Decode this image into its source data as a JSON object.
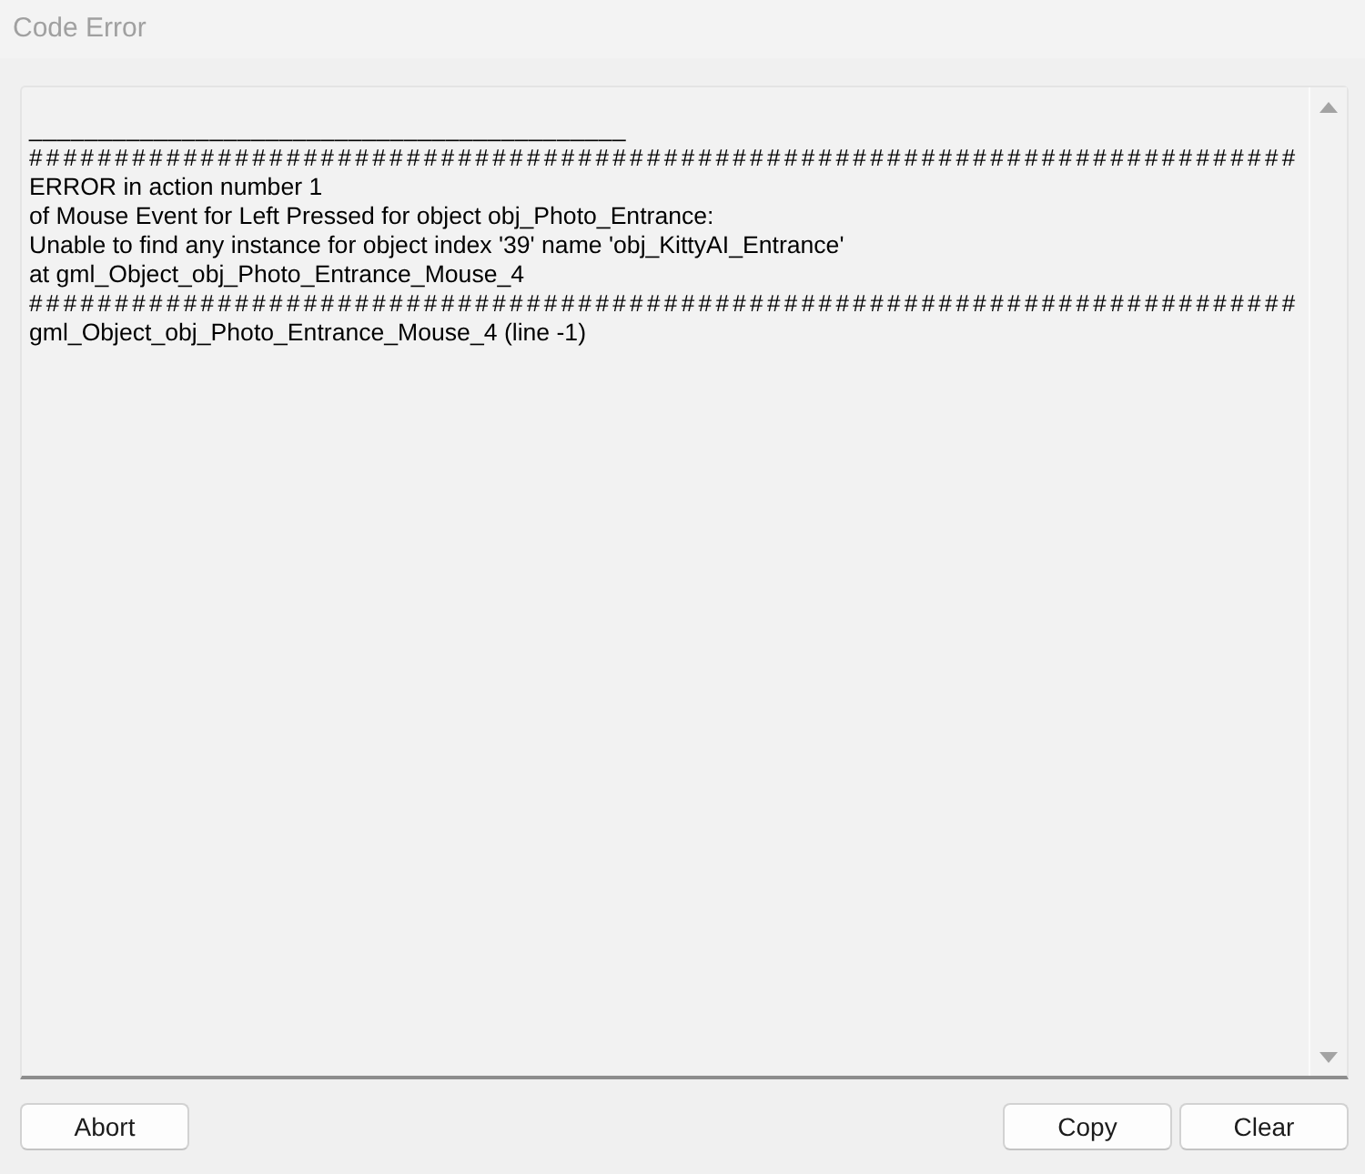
{
  "window": {
    "title": "Code Error"
  },
  "error_log": {
    "lines": [
      {
        "kind": "header",
        "text": "___________________________________________"
      },
      {
        "kind": "separator",
        "text": "##########################################################################"
      },
      {
        "kind": "message",
        "text": "ERROR in action number 1"
      },
      {
        "kind": "message",
        "text": "of Mouse Event for Left Pressed for object obj_Photo_Entrance:"
      },
      {
        "kind": "message",
        "text": "Unable to find any instance for object index '39' name 'obj_KittyAI_Entrance'"
      },
      {
        "kind": "message",
        "text": "at gml_Object_obj_Photo_Entrance_Mouse_4"
      },
      {
        "kind": "separator",
        "text": "##########################################################################"
      },
      {
        "kind": "message",
        "text": "gml_Object_obj_Photo_Entrance_Mouse_4 (line -1)"
      }
    ]
  },
  "buttons": {
    "left": [
      {
        "label": "Abort"
      }
    ],
    "right": [
      {
        "label": "Copy"
      },
      {
        "label": "Clear"
      }
    ]
  }
}
